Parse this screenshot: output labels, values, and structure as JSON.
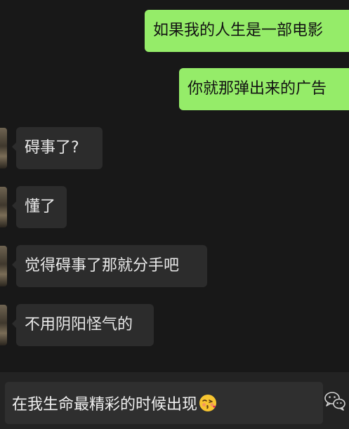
{
  "conversation": {
    "messages": [
      {
        "side": "sent",
        "text": "如果我的人生是一部电影"
      },
      {
        "side": "sent",
        "text": "你就那弹出来的广告"
      },
      {
        "side": "received",
        "text": "碍事了?"
      },
      {
        "side": "received",
        "text": "懂了"
      },
      {
        "side": "received",
        "text": "觉得碍事了那就分手吧"
      },
      {
        "side": "received",
        "text": "不用阴阳怪气的"
      }
    ]
  },
  "composer": {
    "input_text": "在我生命最精彩的时候出现",
    "emoji_icon": "kissing-face-emoji"
  },
  "colors": {
    "background": "#181818",
    "sent_bubble": "#95ec69",
    "received_bubble": "#2c2c2c",
    "composer_bar": "#232323",
    "composer_field": "#2f2f2f"
  },
  "icons": {
    "watermark": "wechat-logo-icon"
  }
}
